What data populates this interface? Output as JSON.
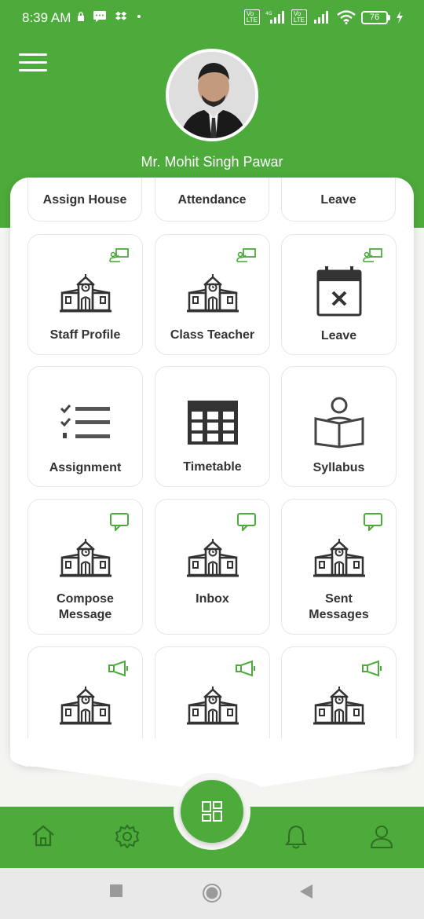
{
  "status_bar": {
    "time": "8:39 AM",
    "battery": "76",
    "icons": [
      "lock-icon",
      "message-icon",
      "dropbox-icon",
      "dot-icon",
      "volte-signal-icon",
      "wifi-icon",
      "charging-icon"
    ]
  },
  "header": {
    "user_name": "Mr. Mohit Singh Pawar",
    "menu_icon": "hamburger-icon"
  },
  "top_row": [
    {
      "label": "Assign House"
    },
    {
      "label": "Attendance"
    },
    {
      "label": "Leave"
    }
  ],
  "tiles": [
    {
      "label": "Staff Profile",
      "icon": "school-building-icon",
      "corner_icon": "teacher-board-icon"
    },
    {
      "label": "Class Teacher",
      "icon": "school-building-icon",
      "corner_icon": "teacher-board-icon"
    },
    {
      "label": "Leave",
      "icon": "calendar-cross-icon",
      "corner_icon": "teacher-board-icon"
    },
    {
      "label": "Assignment",
      "icon": "checklist-icon",
      "corner_icon": ""
    },
    {
      "label": "Timetable",
      "icon": "grid-table-icon",
      "corner_icon": ""
    },
    {
      "label": "Syllabus",
      "icon": "reader-book-icon",
      "corner_icon": ""
    },
    {
      "label": "Compose\nMessage",
      "label_line1": "Compose",
      "label_line2": "Message",
      "icon": "school-building-icon",
      "corner_icon": "chat-bubble-icon"
    },
    {
      "label": "Inbox",
      "icon": "school-building-icon",
      "corner_icon": "chat-bubble-icon"
    },
    {
      "label": "Sent\nMessages",
      "label_line1": "Sent",
      "label_line2": "Messages",
      "icon": "school-building-icon",
      "corner_icon": "chat-bubble-icon"
    },
    {
      "label": "",
      "icon": "school-building-icon",
      "corner_icon": "megaphone-icon"
    },
    {
      "label": "",
      "icon": "school-building-icon",
      "corner_icon": "megaphone-icon"
    },
    {
      "label": "",
      "icon": "school-building-icon",
      "corner_icon": "megaphone-icon"
    }
  ],
  "bottom_nav": [
    "home-icon",
    "settings-icon",
    "dashboard-icon",
    "bell-icon",
    "profile-icon"
  ],
  "colors": {
    "accent": "#4cab3a",
    "background": "#f4f4f1",
    "text": "#333333"
  }
}
